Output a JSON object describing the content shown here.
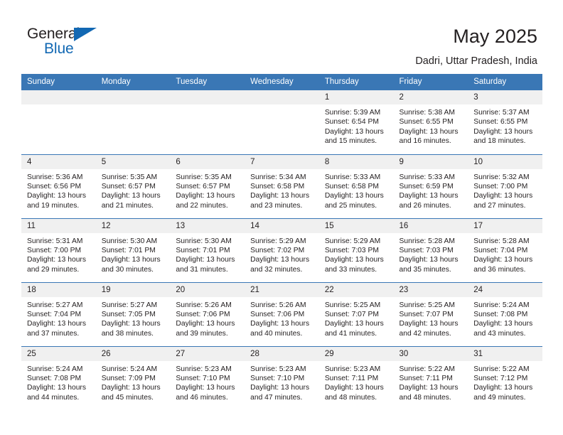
{
  "brand": {
    "name_part1": "General",
    "name_part2": "Blue",
    "accent_color": "#1268b3"
  },
  "header": {
    "title": "May 2025",
    "subtitle": "Dadri, Uttar Pradesh, India"
  },
  "theme": {
    "header_bg": "#3a77b5",
    "daynum_bg": "#f0f0f0",
    "text": "#231f20"
  },
  "weekday_headers": [
    "Sunday",
    "Monday",
    "Tuesday",
    "Wednesday",
    "Thursday",
    "Friday",
    "Saturday"
  ],
  "weeks": [
    [
      {
        "day": "",
        "blank": true,
        "sunrise": "",
        "sunset": "",
        "daylight_line1": "",
        "daylight_line2": ""
      },
      {
        "day": "",
        "blank": true,
        "sunrise": "",
        "sunset": "",
        "daylight_line1": "",
        "daylight_line2": ""
      },
      {
        "day": "",
        "blank": true,
        "sunrise": "",
        "sunset": "",
        "daylight_line1": "",
        "daylight_line2": ""
      },
      {
        "day": "",
        "blank": true,
        "sunrise": "",
        "sunset": "",
        "daylight_line1": "",
        "daylight_line2": ""
      },
      {
        "day": "1",
        "sunrise": "Sunrise: 5:39 AM",
        "sunset": "Sunset: 6:54 PM",
        "daylight_line1": "Daylight: 13 hours",
        "daylight_line2": "and 15 minutes."
      },
      {
        "day": "2",
        "sunrise": "Sunrise: 5:38 AM",
        "sunset": "Sunset: 6:55 PM",
        "daylight_line1": "Daylight: 13 hours",
        "daylight_line2": "and 16 minutes."
      },
      {
        "day": "3",
        "sunrise": "Sunrise: 5:37 AM",
        "sunset": "Sunset: 6:55 PM",
        "daylight_line1": "Daylight: 13 hours",
        "daylight_line2": "and 18 minutes."
      }
    ],
    [
      {
        "day": "4",
        "sunrise": "Sunrise: 5:36 AM",
        "sunset": "Sunset: 6:56 PM",
        "daylight_line1": "Daylight: 13 hours",
        "daylight_line2": "and 19 minutes."
      },
      {
        "day": "5",
        "sunrise": "Sunrise: 5:35 AM",
        "sunset": "Sunset: 6:57 PM",
        "daylight_line1": "Daylight: 13 hours",
        "daylight_line2": "and 21 minutes."
      },
      {
        "day": "6",
        "sunrise": "Sunrise: 5:35 AM",
        "sunset": "Sunset: 6:57 PM",
        "daylight_line1": "Daylight: 13 hours",
        "daylight_line2": "and 22 minutes."
      },
      {
        "day": "7",
        "sunrise": "Sunrise: 5:34 AM",
        "sunset": "Sunset: 6:58 PM",
        "daylight_line1": "Daylight: 13 hours",
        "daylight_line2": "and 23 minutes."
      },
      {
        "day": "8",
        "sunrise": "Sunrise: 5:33 AM",
        "sunset": "Sunset: 6:58 PM",
        "daylight_line1": "Daylight: 13 hours",
        "daylight_line2": "and 25 minutes."
      },
      {
        "day": "9",
        "sunrise": "Sunrise: 5:33 AM",
        "sunset": "Sunset: 6:59 PM",
        "daylight_line1": "Daylight: 13 hours",
        "daylight_line2": "and 26 minutes."
      },
      {
        "day": "10",
        "sunrise": "Sunrise: 5:32 AM",
        "sunset": "Sunset: 7:00 PM",
        "daylight_line1": "Daylight: 13 hours",
        "daylight_line2": "and 27 minutes."
      }
    ],
    [
      {
        "day": "11",
        "sunrise": "Sunrise: 5:31 AM",
        "sunset": "Sunset: 7:00 PM",
        "daylight_line1": "Daylight: 13 hours",
        "daylight_line2": "and 29 minutes."
      },
      {
        "day": "12",
        "sunrise": "Sunrise: 5:30 AM",
        "sunset": "Sunset: 7:01 PM",
        "daylight_line1": "Daylight: 13 hours",
        "daylight_line2": "and 30 minutes."
      },
      {
        "day": "13",
        "sunrise": "Sunrise: 5:30 AM",
        "sunset": "Sunset: 7:01 PM",
        "daylight_line1": "Daylight: 13 hours",
        "daylight_line2": "and 31 minutes."
      },
      {
        "day": "14",
        "sunrise": "Sunrise: 5:29 AM",
        "sunset": "Sunset: 7:02 PM",
        "daylight_line1": "Daylight: 13 hours",
        "daylight_line2": "and 32 minutes."
      },
      {
        "day": "15",
        "sunrise": "Sunrise: 5:29 AM",
        "sunset": "Sunset: 7:03 PM",
        "daylight_line1": "Daylight: 13 hours",
        "daylight_line2": "and 33 minutes."
      },
      {
        "day": "16",
        "sunrise": "Sunrise: 5:28 AM",
        "sunset": "Sunset: 7:03 PM",
        "daylight_line1": "Daylight: 13 hours",
        "daylight_line2": "and 35 minutes."
      },
      {
        "day": "17",
        "sunrise": "Sunrise: 5:28 AM",
        "sunset": "Sunset: 7:04 PM",
        "daylight_line1": "Daylight: 13 hours",
        "daylight_line2": "and 36 minutes."
      }
    ],
    [
      {
        "day": "18",
        "sunrise": "Sunrise: 5:27 AM",
        "sunset": "Sunset: 7:04 PM",
        "daylight_line1": "Daylight: 13 hours",
        "daylight_line2": "and 37 minutes."
      },
      {
        "day": "19",
        "sunrise": "Sunrise: 5:27 AM",
        "sunset": "Sunset: 7:05 PM",
        "daylight_line1": "Daylight: 13 hours",
        "daylight_line2": "and 38 minutes."
      },
      {
        "day": "20",
        "sunrise": "Sunrise: 5:26 AM",
        "sunset": "Sunset: 7:06 PM",
        "daylight_line1": "Daylight: 13 hours",
        "daylight_line2": "and 39 minutes."
      },
      {
        "day": "21",
        "sunrise": "Sunrise: 5:26 AM",
        "sunset": "Sunset: 7:06 PM",
        "daylight_line1": "Daylight: 13 hours",
        "daylight_line2": "and 40 minutes."
      },
      {
        "day": "22",
        "sunrise": "Sunrise: 5:25 AM",
        "sunset": "Sunset: 7:07 PM",
        "daylight_line1": "Daylight: 13 hours",
        "daylight_line2": "and 41 minutes."
      },
      {
        "day": "23",
        "sunrise": "Sunrise: 5:25 AM",
        "sunset": "Sunset: 7:07 PM",
        "daylight_line1": "Daylight: 13 hours",
        "daylight_line2": "and 42 minutes."
      },
      {
        "day": "24",
        "sunrise": "Sunrise: 5:24 AM",
        "sunset": "Sunset: 7:08 PM",
        "daylight_line1": "Daylight: 13 hours",
        "daylight_line2": "and 43 minutes."
      }
    ],
    [
      {
        "day": "25",
        "sunrise": "Sunrise: 5:24 AM",
        "sunset": "Sunset: 7:08 PM",
        "daylight_line1": "Daylight: 13 hours",
        "daylight_line2": "and 44 minutes."
      },
      {
        "day": "26",
        "sunrise": "Sunrise: 5:24 AM",
        "sunset": "Sunset: 7:09 PM",
        "daylight_line1": "Daylight: 13 hours",
        "daylight_line2": "and 45 minutes."
      },
      {
        "day": "27",
        "sunrise": "Sunrise: 5:23 AM",
        "sunset": "Sunset: 7:10 PM",
        "daylight_line1": "Daylight: 13 hours",
        "daylight_line2": "and 46 minutes."
      },
      {
        "day": "28",
        "sunrise": "Sunrise: 5:23 AM",
        "sunset": "Sunset: 7:10 PM",
        "daylight_line1": "Daylight: 13 hours",
        "daylight_line2": "and 47 minutes."
      },
      {
        "day": "29",
        "sunrise": "Sunrise: 5:23 AM",
        "sunset": "Sunset: 7:11 PM",
        "daylight_line1": "Daylight: 13 hours",
        "daylight_line2": "and 48 minutes."
      },
      {
        "day": "30",
        "sunrise": "Sunrise: 5:22 AM",
        "sunset": "Sunset: 7:11 PM",
        "daylight_line1": "Daylight: 13 hours",
        "daylight_line2": "and 48 minutes."
      },
      {
        "day": "31",
        "sunrise": "Sunrise: 5:22 AM",
        "sunset": "Sunset: 7:12 PM",
        "daylight_line1": "Daylight: 13 hours",
        "daylight_line2": "and 49 minutes."
      }
    ]
  ]
}
